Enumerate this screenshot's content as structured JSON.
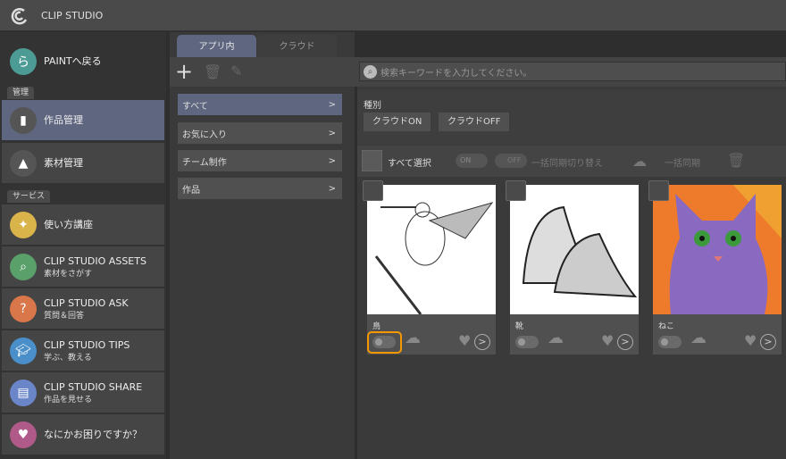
{
  "app": {
    "title": "CLIP STUDIO"
  },
  "sidebar": {
    "back": "PAINTへ戻る",
    "section_manage": "管理",
    "manage_items": [
      {
        "label": "作品管理",
        "selected": true
      },
      {
        "label": "素材管理"
      }
    ],
    "section_service": "サービス",
    "service_items": [
      {
        "label": "使い方講座",
        "sub": ""
      },
      {
        "label": "CLIP STUDIO ASSETS",
        "sub": "素材をさがす"
      },
      {
        "label": "CLIP STUDIO ASK",
        "sub": "質問＆回答"
      },
      {
        "label": "CLIP STUDIO TIPS",
        "sub": "学ぶ、教える"
      },
      {
        "label": "CLIP STUDIO SHARE",
        "sub": "作品を見せる"
      },
      {
        "label": "なにかお困りですか？",
        "sub": ""
      }
    ]
  },
  "tabs": [
    {
      "label": "アプリ内",
      "active": true
    },
    {
      "label": "クラウド"
    }
  ],
  "categories": [
    {
      "label": "すべて",
      "selected": true
    },
    {
      "label": "お気に入り"
    },
    {
      "label": "チーム制作"
    },
    {
      "label": "作品"
    }
  ],
  "search": {
    "placeholder": "検索キーワードを入力してください。"
  },
  "filter": {
    "heading": "種別",
    "buttons": [
      "クラウドON",
      "クラウドOFF"
    ]
  },
  "selectbar": {
    "select_all": "すべて選択",
    "on": "ON",
    "off": "OFF",
    "bulk_toggle": "一括同期切り替え",
    "bulk_sync": "一括同期"
  },
  "works": [
    {
      "name": "鳥",
      "highlight": true
    },
    {
      "name": "靴"
    },
    {
      "name": "ねこ"
    }
  ],
  "colors": {
    "accent": "#5f6680",
    "highlight": "#f39800",
    "cat_bg": "#ee7a2c"
  }
}
